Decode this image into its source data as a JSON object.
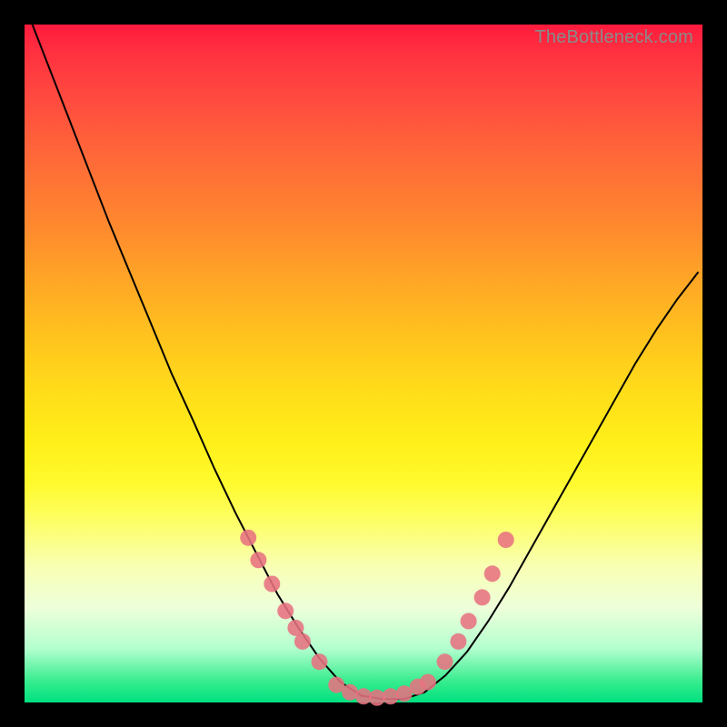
{
  "watermark": "TheBottleneck.com",
  "colors": {
    "frame": "#000000",
    "curve": "#000000",
    "dot": "#e77281",
    "gradient_top": "#ff1a3d",
    "gradient_bottom": "#00e080"
  },
  "chart_data": {
    "type": "line",
    "title": "",
    "xlabel": "",
    "ylabel": "",
    "xlim": [
      0,
      100
    ],
    "ylim": [
      0,
      100
    ],
    "note": "Bottleneck-style V-curve. Y≈100 is top (worst), Y≈0 is bottom (best). No numeric axes shown; values are read from plot geometry.",
    "series": [
      {
        "name": "bottleneck-curve",
        "x": [
          0.0,
          3.1,
          6.2,
          9.3,
          12.4,
          15.5,
          18.6,
          21.7,
          24.9,
          28.0,
          31.1,
          34.2,
          37.3,
          40.4,
          43.5,
          46.6,
          49.7,
          52.8,
          55.9,
          59.0,
          62.1,
          65.3,
          68.4,
          71.5,
          74.6,
          77.7,
          80.8,
          83.9,
          87.0,
          90.1,
          93.2,
          96.3,
          99.4
        ],
        "y": [
          103.0,
          95.0,
          87.0,
          79.0,
          71.0,
          63.5,
          56.0,
          48.5,
          41.5,
          34.5,
          28.0,
          22.0,
          16.0,
          11.0,
          6.5,
          3.0,
          1.0,
          0.5,
          0.5,
          1.5,
          4.0,
          7.5,
          12.0,
          17.0,
          22.5,
          28.0,
          33.5,
          39.0,
          44.5,
          50.0,
          55.0,
          59.5,
          63.5
        ]
      }
    ],
    "markers": [
      {
        "name": "left-cluster",
        "x": 33.0,
        "y": 24.3
      },
      {
        "name": "left-cluster",
        "x": 34.5,
        "y": 21.0
      },
      {
        "name": "left-cluster",
        "x": 36.5,
        "y": 17.5
      },
      {
        "name": "left-cluster",
        "x": 38.5,
        "y": 13.5
      },
      {
        "name": "left-cluster",
        "x": 40.0,
        "y": 11.0
      },
      {
        "name": "left-cluster",
        "x": 41.0,
        "y": 9.0
      },
      {
        "name": "left-cluster",
        "x": 43.5,
        "y": 6.0
      },
      {
        "name": "bottom",
        "x": 46.0,
        "y": 2.6
      },
      {
        "name": "bottom",
        "x": 48.0,
        "y": 1.5
      },
      {
        "name": "bottom",
        "x": 50.0,
        "y": 0.9
      },
      {
        "name": "bottom",
        "x": 52.0,
        "y": 0.7
      },
      {
        "name": "bottom",
        "x": 54.0,
        "y": 0.9
      },
      {
        "name": "bottom",
        "x": 56.0,
        "y": 1.3
      },
      {
        "name": "bottom",
        "x": 58.0,
        "y": 2.3
      },
      {
        "name": "right-cluster",
        "x": 59.5,
        "y": 3.0
      },
      {
        "name": "right-cluster",
        "x": 62.0,
        "y": 6.0
      },
      {
        "name": "right-cluster",
        "x": 64.0,
        "y": 9.0
      },
      {
        "name": "right-cluster",
        "x": 65.5,
        "y": 12.0
      },
      {
        "name": "right-cluster",
        "x": 67.5,
        "y": 15.5
      },
      {
        "name": "right-cluster",
        "x": 69.0,
        "y": 19.0
      },
      {
        "name": "right-cluster",
        "x": 71.0,
        "y": 24.0
      }
    ]
  }
}
